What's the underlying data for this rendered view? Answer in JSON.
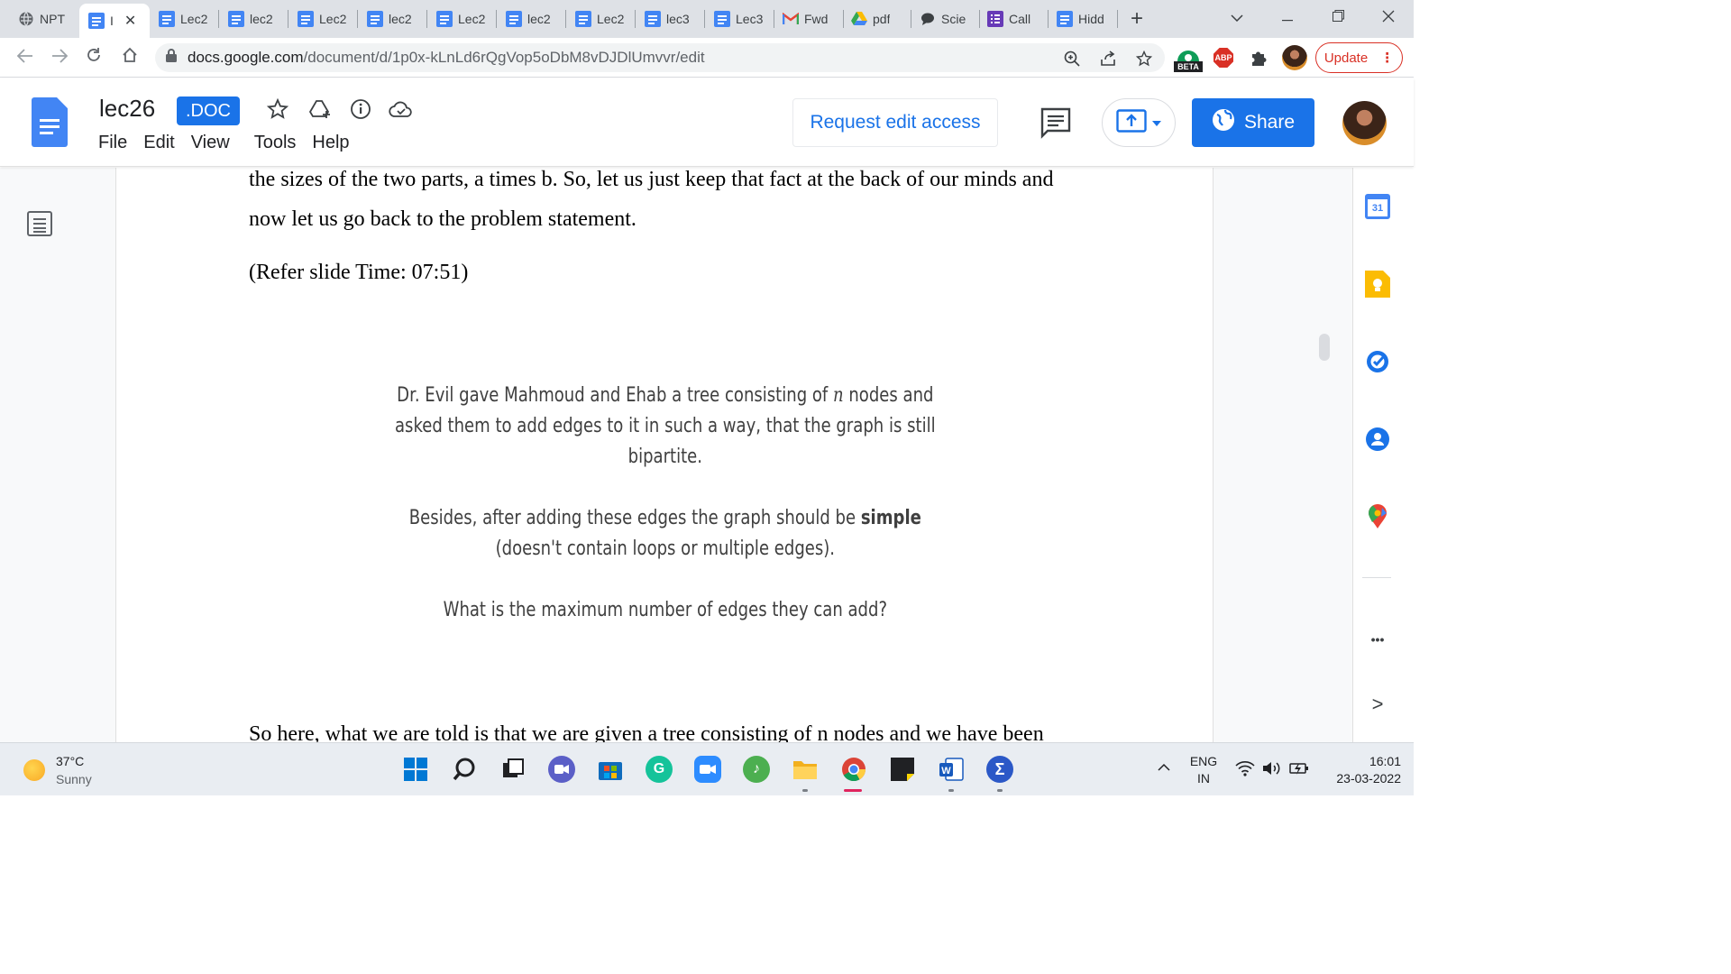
{
  "browser": {
    "tabs": [
      {
        "label": "NPT",
        "icon": "globe-icon",
        "active": false
      },
      {
        "label": "I",
        "icon": "google-docs-icon",
        "active": true
      },
      {
        "label": "Lec2",
        "icon": "google-docs-icon",
        "active": false
      },
      {
        "label": "lec2",
        "icon": "google-docs-icon",
        "active": false
      },
      {
        "label": "Lec2",
        "icon": "google-docs-icon",
        "active": false
      },
      {
        "label": "lec2",
        "icon": "google-docs-icon",
        "active": false
      },
      {
        "label": "Lec2",
        "icon": "google-docs-icon",
        "active": false
      },
      {
        "label": "lec2",
        "icon": "google-docs-icon",
        "active": false
      },
      {
        "label": "Lec2",
        "icon": "google-docs-icon",
        "active": false
      },
      {
        "label": "lec3",
        "icon": "google-docs-icon",
        "active": false
      },
      {
        "label": "Lec3",
        "icon": "google-docs-icon",
        "active": false
      },
      {
        "label": "Fwd",
        "icon": "gmail-icon",
        "active": false
      },
      {
        "label": "pdf",
        "icon": "google-drive-icon",
        "active": false
      },
      {
        "label": "Scie",
        "icon": "chat-icon",
        "active": false
      },
      {
        "label": "Call",
        "icon": "forms-icon",
        "active": false
      },
      {
        "label": "Hidd",
        "icon": "google-docs-icon",
        "active": false
      }
    ],
    "new_tab_label": "+",
    "url_host": "docs.google.com",
    "url_path": "/document/d/1p0x-kLnLd6rQgVop5oDbM8vDJDlUmvvr/edit",
    "beta_badge": "BETA",
    "abp_label": "ABP",
    "update_label": "Update"
  },
  "docs": {
    "title": "lec26",
    "badge": ".DOC",
    "menu": [
      "File",
      "Edit",
      "View",
      "Tools",
      "Help"
    ],
    "request_edit_label": "Request edit access",
    "share_label": "Share"
  },
  "document": {
    "lines": [
      "the sizes of the two parts, a times b. So, let us just keep that fact at the back of our minds and",
      "now let us go back to the problem statement.",
      "(Refer slide Time: 07:51)"
    ],
    "slide": {
      "p1_l1_pre": "Dr. Evil gave Mahmoud and Ehab a tree consisting of ",
      "p1_l1_var": "n",
      "p1_l1_post": " nodes and",
      "p1_l2": "asked them to add edges to it in such a way, that the graph is still",
      "p1_l3": "bipartite.",
      "p2_l1_pre": "Besides, after adding these edges the graph should be ",
      "p2_l1_bold": "simple",
      "p2_l2": "(doesn't contain loops or multiple edges).",
      "p3": "What is the maximum number of edges they can add?"
    },
    "last_line": "So here, what we are told is that we are given a tree consisting of n nodes and we have been"
  },
  "side_panel": {
    "calendar_day": "31",
    "more_label": "•••",
    "expand_label": ">"
  },
  "taskbar": {
    "weather_temp": "37°C",
    "weather_desc": "Sunny",
    "lang_line1": "ENG",
    "lang_line2": "IN",
    "time": "16:01",
    "date": "23-03-2022"
  },
  "colors": {
    "docs_blue": "#1a73e8",
    "update_red": "#d93025",
    "tabstrip_bg": "#dee1e6"
  }
}
